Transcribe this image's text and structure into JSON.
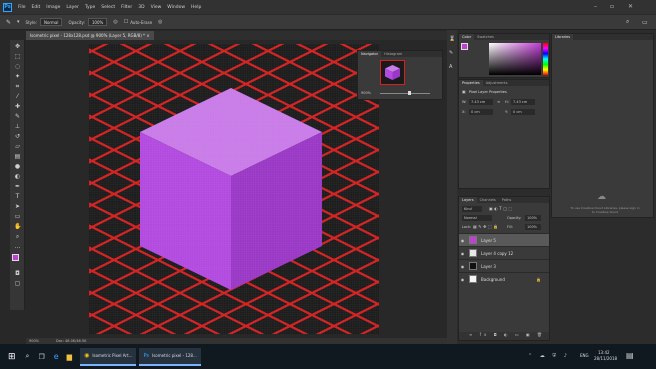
{
  "app": {
    "logo": "Ps"
  },
  "menu": [
    "File",
    "Edit",
    "Image",
    "Layer",
    "Type",
    "Select",
    "Filter",
    "3D",
    "View",
    "Window",
    "Help"
  ],
  "options": {
    "style_label": "Style:",
    "style_value": "Normal",
    "opacity_label": "Opacity:",
    "opacity_value": "100%",
    "autoerase_label": "Auto-Erase"
  },
  "document": {
    "tab_label": "Isometric pixel - 128x128.psd @ 900% (Layer 5, RGB/8) * ×"
  },
  "status": {
    "zoom": "900%",
    "doc_info": "Doc: 48.0K/46.5K"
  },
  "navigator": {
    "tabs": [
      "Navigator",
      "Histogram"
    ],
    "zoom": "900%"
  },
  "color_panel": {
    "tabs": [
      "Color",
      "Swatches"
    ]
  },
  "properties": {
    "tabs": [
      "Properties",
      "Adjustments"
    ],
    "title": "Pixel Layer Properties",
    "w_label": "W:",
    "w_value": "7.43 cm",
    "h_label": "H:",
    "h_value": "7.43 cm",
    "x_label": "X:",
    "x_value": "0 cm",
    "y_label": "Y:",
    "y_value": "0 cm"
  },
  "library": {
    "tab": "Libraries",
    "message": "To use Creative Cloud Libraries, please sign in to Creative Cloud"
  },
  "layers": {
    "tabs": [
      "Layers",
      "Channels",
      "Paths"
    ],
    "kind": "Kind",
    "blend": "Normal",
    "opacity_label": "Opacity:",
    "opacity": "100%",
    "lock_label": "Lock:",
    "fill_label": "Fill:",
    "fill": "100%",
    "items": [
      {
        "name": "Layer 5",
        "selected": true,
        "thumb": "#c23fd6"
      },
      {
        "name": "Layer 4 copy 12",
        "selected": false,
        "thumb": "#e8e8e8"
      },
      {
        "name": "Layer 3",
        "selected": false,
        "thumb": "#111111"
      },
      {
        "name": "Background",
        "selected": false,
        "thumb": "#f4f4f4"
      }
    ]
  },
  "taskbar": {
    "apps": [
      "Isometric Pixel Art...",
      "Isometric pixel - 128..."
    ],
    "time": "13:42",
    "date": "28/11/2018",
    "lang": "ENG"
  },
  "colors": {
    "cube_top": "#c97be8",
    "cube_left": "#b24ae0",
    "cube_right": "#9a38c6",
    "grid_line": "#d42020",
    "grid_bg": "#1c1c1c"
  }
}
